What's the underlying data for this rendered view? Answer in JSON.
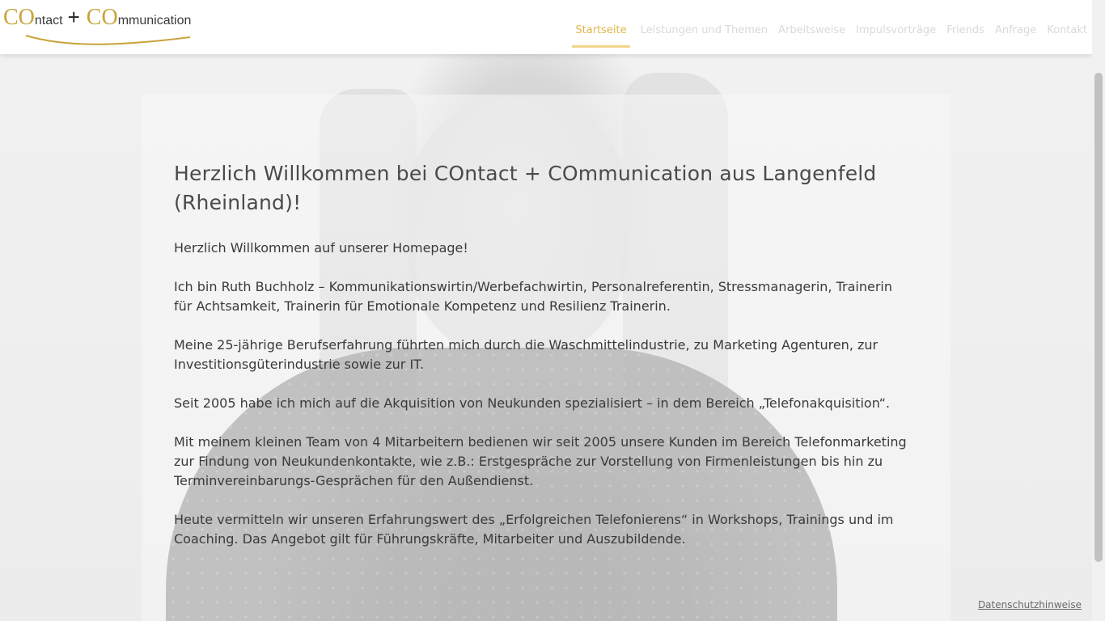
{
  "logo": {
    "co1": "CO",
    "ntact": "ntact",
    "plus": "+",
    "co2": "CO",
    "mmunication": "mmunication"
  },
  "nav": {
    "items": [
      {
        "label": "Startseite",
        "active": true
      },
      {
        "label": "Leistungen und Themen",
        "active": false
      },
      {
        "label": "Arbeitsweise",
        "active": false
      },
      {
        "label": "Impulsvorträge",
        "active": false
      },
      {
        "label": "Friends",
        "active": false
      },
      {
        "label": "Anfrage",
        "active": false
      },
      {
        "label": "Kontakt",
        "active": false
      }
    ]
  },
  "main": {
    "heading": "Herzlich Willkommen bei COntact + COmmunication aus Langenfeld (Rheinland)!",
    "paragraphs": [
      "Herzlich Willkommen auf unserer Homepage!",
      "Ich bin Ruth Buchholz – Kommunikationswirtin/Werbefachwirtin, Personalreferentin,  Stressmanagerin, Trainerin für Achtsamkeit, Trainerin für Emotionale Kompetenz und Resilienz Trainerin.",
      "Meine 25-jährige Berufserfahrung führten mich durch die Waschmittelindustrie, zu Marketing Agenturen, zur Investitionsgüterindustrie sowie zur IT.",
      "Seit 2005 habe ich mich auf die Akquisition von Neukunden spezialisiert – in dem Bereich „Telefonakquisition“.",
      "Mit meinem kleinen Team von 4 Mitarbeitern bedienen wir seit 2005 unsere Kunden im Bereich Telefonmarketing zur Findung von Neukundenkontakte, wie z.B.: Erstgespräche zur Vorstellung von Firmenleistungen bis hin zu Terminvereinbarungs-Gesprächen für den Außendienst.",
      "Heute vermitteln wir unseren Erfahrungswert des „Erfolgreichen Telefonierens“ in Workshops, Trainings und im Coaching. Das Angebot gilt für Führungskräfte, Mitarbeiter und Auszubildende."
    ]
  },
  "footer": {
    "privacy_label": "Datenschutzhinweise"
  },
  "colors": {
    "accent": "#e1b74b",
    "logo_gold": "#c9a43b",
    "nav_inactive": "#d9d9d9"
  }
}
